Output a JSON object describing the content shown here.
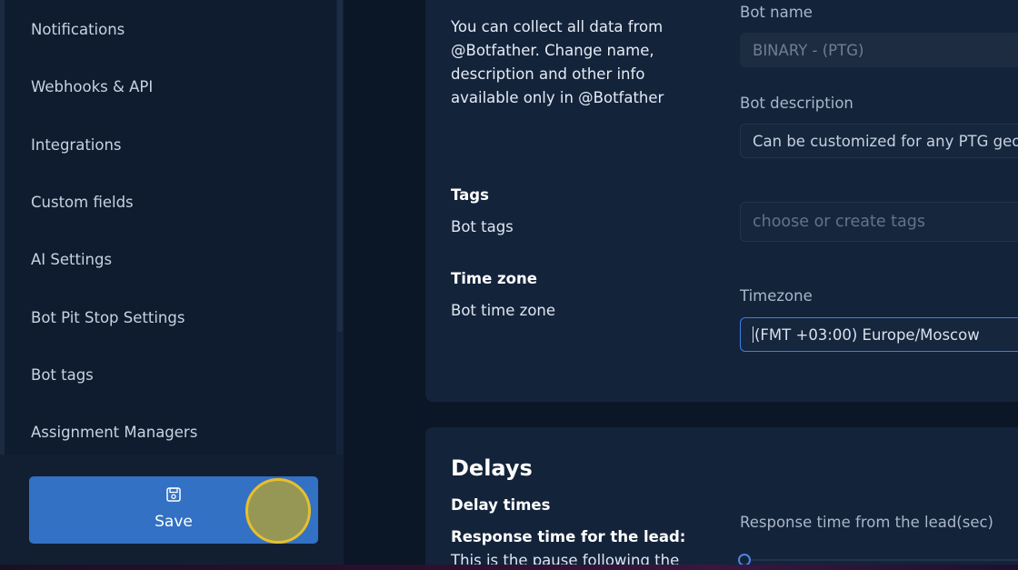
{
  "sidebar": {
    "items": [
      {
        "label": "Notifications"
      },
      {
        "label": "Webhooks & API"
      },
      {
        "label": "Integrations"
      },
      {
        "label": "Custom fields"
      },
      {
        "label": "AI Settings"
      },
      {
        "label": "Bot Pit Stop Settings"
      },
      {
        "label": "Bot tags"
      },
      {
        "label": "Assignment Managers"
      }
    ],
    "save_button": {
      "label": "Save",
      "icon": "save-icon"
    }
  },
  "general": {
    "description": "You can collect all data from @Botfather. Change name, description and other info available only in @Botfather",
    "bot_name": {
      "label": "Bot name",
      "value": "BINARY - (PTG)"
    },
    "bot_description": {
      "label": "Bot description",
      "value": "Can be customized for any PTG geo"
    },
    "tags": {
      "title": "Tags",
      "subtitle": "Bot tags",
      "placeholder": "choose or create tags"
    },
    "time_zone": {
      "title": "Time zone",
      "subtitle": "Bot time zone",
      "label": "Timezone",
      "value": "(FMT +03:00) Europe/Moscow"
    }
  },
  "delays": {
    "title": "Delays",
    "subtitle": "Delay times",
    "response_lead_bold": "Response time for the lead:",
    "response_lead_text": " This is the pause following the receipt",
    "response_time_label": "Response time from the lead(sec)"
  },
  "colors": {
    "accent": "#3271c4",
    "focus_border": "#3d7fe6",
    "click_indicator": "#e7be2d"
  }
}
